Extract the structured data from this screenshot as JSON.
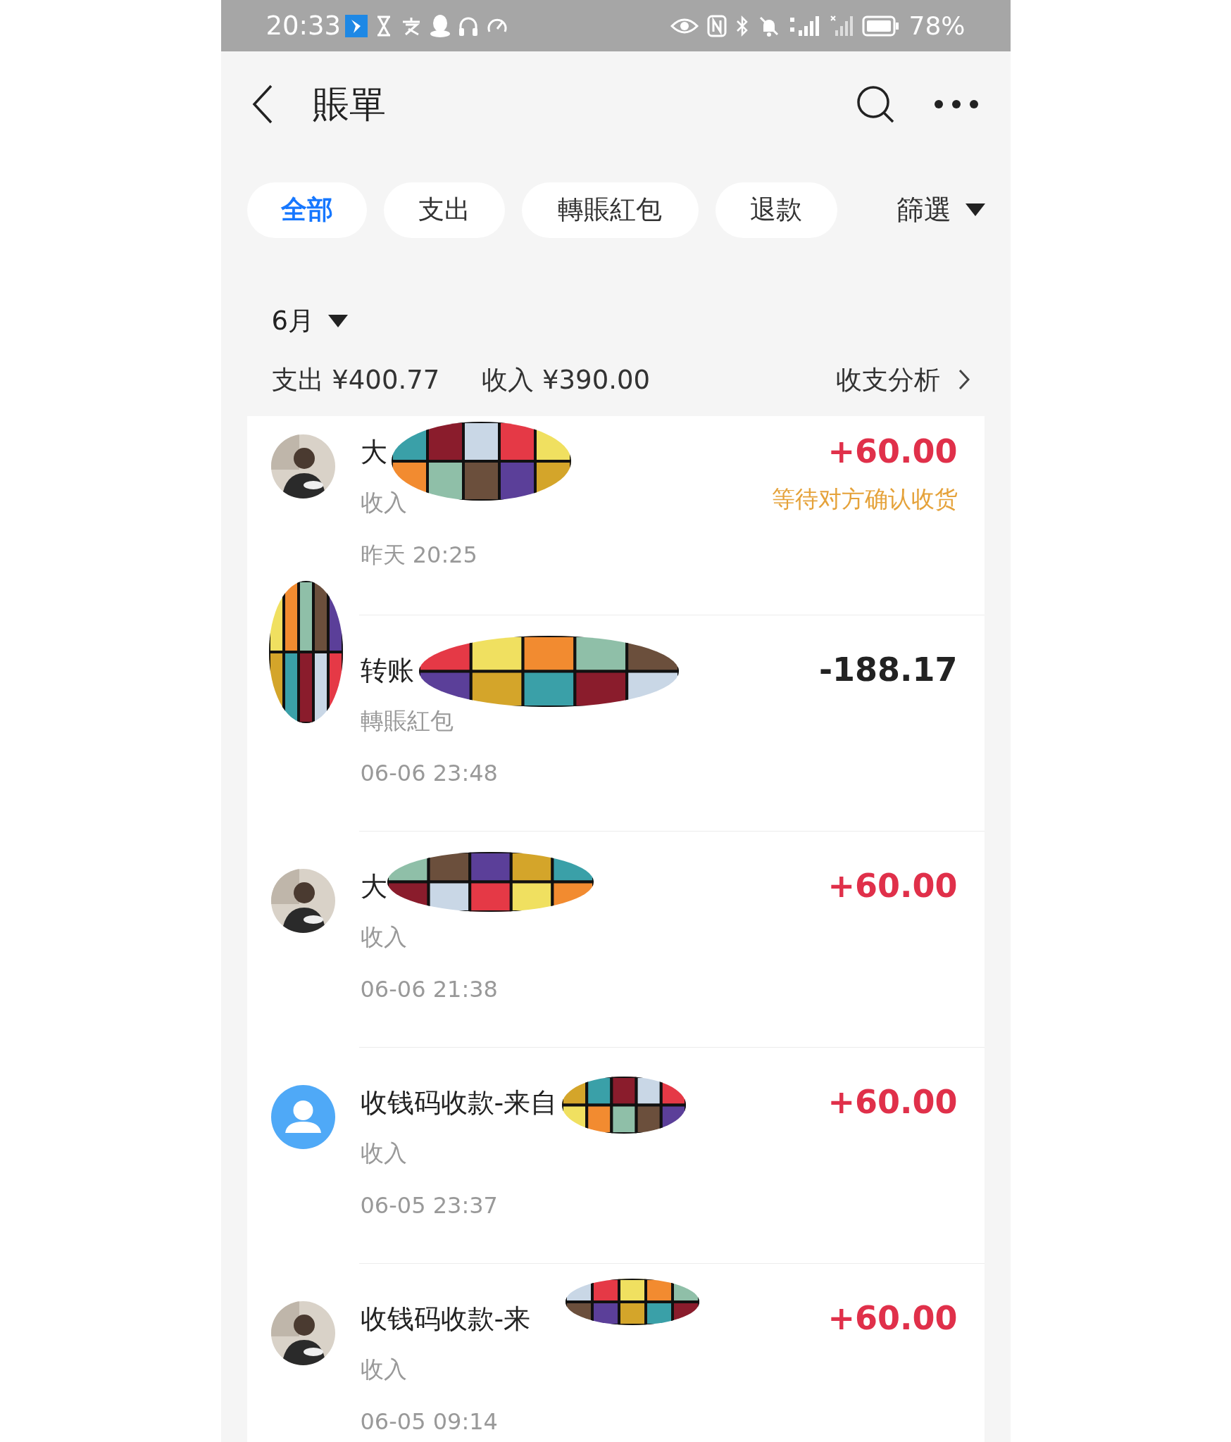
{
  "status_bar": {
    "time": "20:33",
    "battery": "78%"
  },
  "header": {
    "title": "賬單"
  },
  "tabs": [
    {
      "label": "全部",
      "selected": true
    },
    {
      "label": "支出",
      "selected": false
    },
    {
      "label": "轉賬紅包",
      "selected": false
    },
    {
      "label": "退款",
      "selected": false
    }
  ],
  "filter": {
    "label": "篩選"
  },
  "summary": {
    "month": "6月",
    "expense": "支出 ¥400.77",
    "income": "收入 ¥390.00",
    "analysis": "收支分析"
  },
  "rows": [
    {
      "title": "大",
      "category": "收入",
      "time": "昨天 20:25",
      "amount": "+60.00",
      "kind": "income",
      "status": "等待对方确认收货"
    },
    {
      "title": "转账",
      "category": "轉賬紅包",
      "time": "06-06 23:48",
      "amount": "-188.17",
      "kind": "expense"
    },
    {
      "title": "大",
      "category": "收入",
      "time": "06-06 21:38",
      "amount": "+60.00",
      "kind": "income"
    },
    {
      "avatar": {
        "kind": "default"
      },
      "title": "收钱码收款-来自",
      "category": "收入",
      "time": "06-05 23:37",
      "amount": "+60.00",
      "kind": "income"
    },
    {
      "title": "收钱码收款-来",
      "category": "收入",
      "time": "06-05 09:14",
      "amount": "+60.00",
      "kind": "income"
    }
  ]
}
